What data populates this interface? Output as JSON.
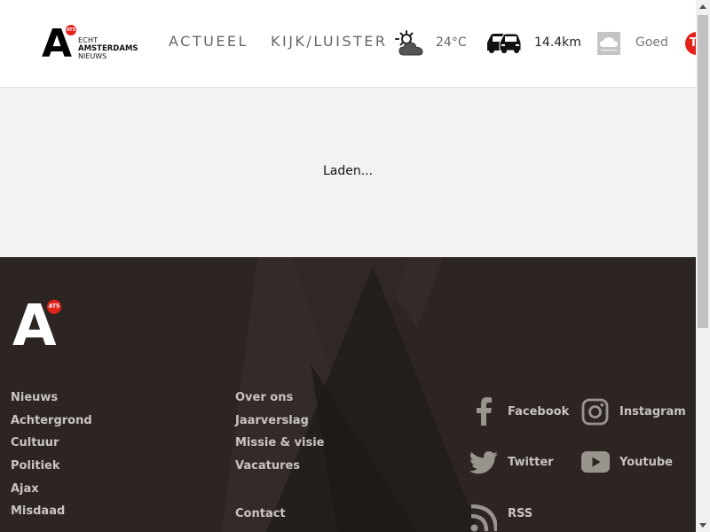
{
  "header": {
    "logo": {
      "letter": "A",
      "badge": "AT5",
      "line1": "ECHT",
      "line2": "AMSTERDAMS",
      "line3": "NIEUWS"
    },
    "nav": [
      "ACTUEEL",
      "KIJK/LUISTER"
    ],
    "weather": {
      "icon": "partly-cloudy-icon",
      "temperature": "24°C"
    },
    "traffic": {
      "icon": "traffic-cars-icon",
      "value": "14.4km"
    },
    "air": {
      "icon": "air-quality-icon",
      "value": "Goed"
    },
    "extra_badge": "T"
  },
  "main": {
    "loading_text": "Laden..."
  },
  "footer": {
    "logo": {
      "letter": "A",
      "badge": "AT5"
    },
    "col1": [
      "Nieuws",
      "Achtergrond",
      "Cultuur",
      "Politiek",
      "Ajax",
      "Misdaad"
    ],
    "col2": [
      "Over ons",
      "Jaarverslag",
      "Missie & visie",
      "Vacatures",
      "Contact"
    ],
    "social": [
      {
        "label": "Facebook",
        "icon": "facebook-icon"
      },
      {
        "label": "Instagram",
        "icon": "instagram-icon"
      },
      {
        "label": "Twitter",
        "icon": "twitter-icon"
      },
      {
        "label": "Youtube",
        "icon": "youtube-icon"
      },
      {
        "label": "RSS",
        "icon": "rss-icon"
      }
    ]
  },
  "colors": {
    "brand_red": "#e3211b",
    "footer_bg": "#2c2522",
    "footer_text": "#c9c4bf"
  }
}
